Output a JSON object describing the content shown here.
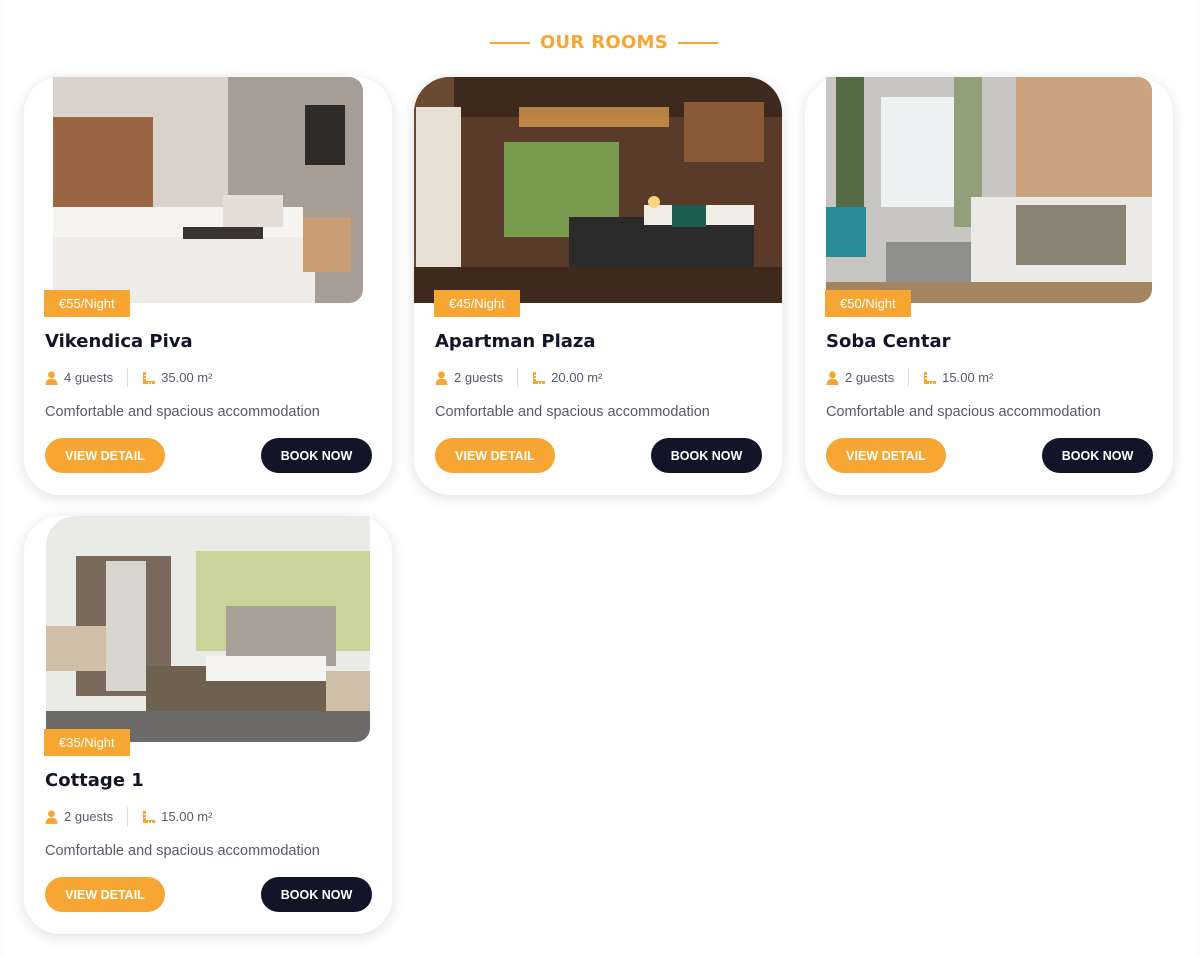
{
  "section": {
    "title": "OUR ROOMS"
  },
  "rooms": [
    {
      "price": "€55/Night",
      "name": "Vikendica Piva",
      "guests": "4 guests",
      "area": "35.00 m²",
      "description": "Comfortable and spacious accommodation",
      "view_label": "VIEW DETAIL",
      "book_label": "BOOK NOW"
    },
    {
      "price": "€45/Night",
      "name": "Apartman Plaza",
      "guests": "2 guests",
      "area": "20.00 m²",
      "description": "Comfortable and spacious accommodation",
      "view_label": "VIEW DETAIL",
      "book_label": "BOOK NOW"
    },
    {
      "price": "€50/Night",
      "name": "Soba Centar",
      "guests": "2 guests",
      "area": "15.00 m²",
      "description": "Comfortable and spacious accommodation",
      "view_label": "VIEW DETAIL",
      "book_label": "BOOK NOW"
    },
    {
      "price": "€35/Night",
      "name": "Cottage 1",
      "guests": "2 guests",
      "area": "15.00 m²",
      "description": "Comfortable and spacious accommodation",
      "view_label": "VIEW DETAIL",
      "book_label": "BOOK NOW"
    }
  ],
  "icons": {
    "guests": "user-icon",
    "area": "ruler-area-icon"
  },
  "colors": {
    "accent": "#f7a634",
    "dark": "#101628",
    "text": "#555b66"
  }
}
